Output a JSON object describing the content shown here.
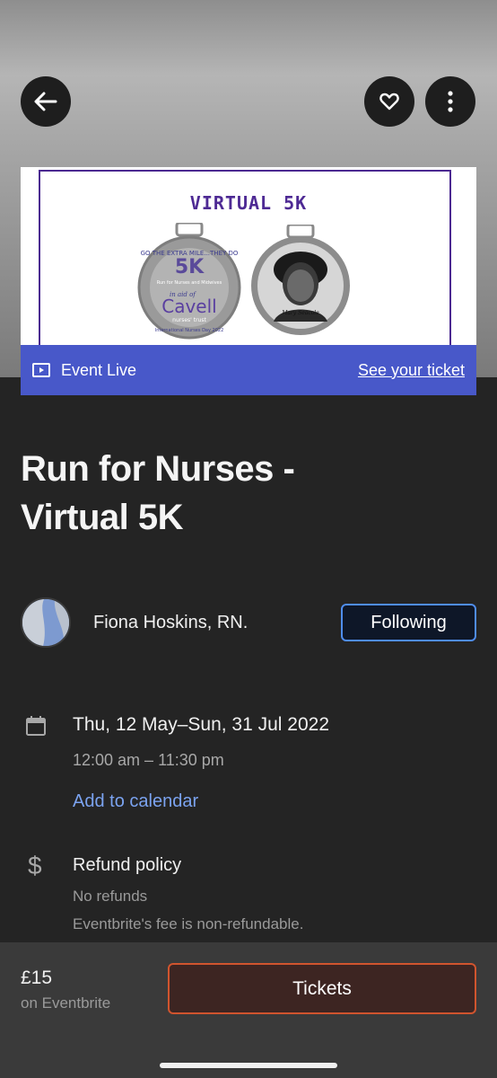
{
  "header": {
    "back_icon": "arrow-left-icon",
    "like_icon": "heart-icon",
    "more_icon": "more-vertical-icon"
  },
  "banner": {
    "title": "VIRTUAL 5K",
    "medal_left_ring_text": "GO THE EXTRA MILE...THEY DO",
    "medal_left_5k": "5K",
    "medal_left_sub": "Run for Nurses and Midwives",
    "medal_left_aid": "in aid of",
    "medal_left_brand": "Cavell",
    "medal_left_brand_sub": "nurses' trust",
    "medal_left_bottom": "International Nurses Day 2022",
    "medal_right_caption": "Mary Seacole",
    "live_icon": "video-icon",
    "live_label": "Event Live",
    "ticket_link": "See your ticket",
    "accent_color": "#4858c9"
  },
  "event": {
    "title_line1": "Run for Nurses -",
    "title_line2": "Virtual 5K"
  },
  "organizer": {
    "name": "Fiona Hoskins, RN.",
    "follow_label": "Following"
  },
  "date": {
    "icon": "calendar-icon",
    "range": "Thu, 12 May–Sun, 31 Jul 2022",
    "time": "12:00 am – 11:30 pm",
    "add_calendar": "Add to calendar"
  },
  "refund": {
    "icon": "dollar-icon",
    "title": "Refund policy",
    "line1": "No refunds",
    "line2": "Eventbrite's fee is non-refundable."
  },
  "footer": {
    "price": "£15",
    "price_sub": "on Eventbrite",
    "tickets_label": "Tickets",
    "tickets_color": "#d0542e"
  }
}
